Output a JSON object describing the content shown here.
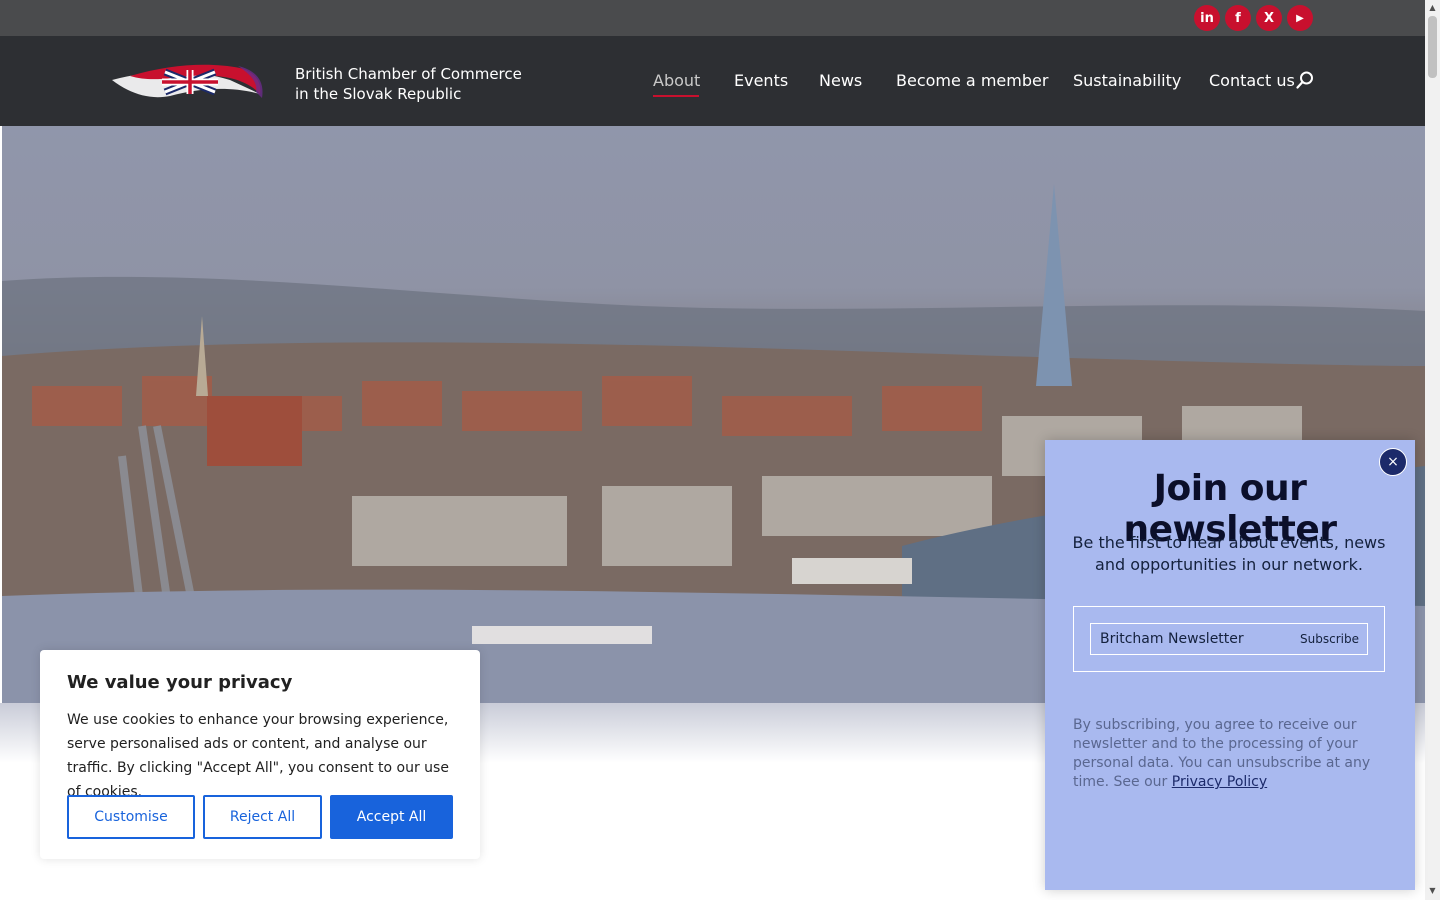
{
  "topbar": {
    "social": [
      {
        "name": "linkedin",
        "glyph": "in"
      },
      {
        "name": "facebook",
        "glyph": "f"
      },
      {
        "name": "x",
        "glyph": "X"
      },
      {
        "name": "youtube",
        "glyph": "▶"
      }
    ]
  },
  "header": {
    "brand_line1": "British Chamber of Commerce",
    "brand_line2": "in the Slovak Republic",
    "nav": [
      "About",
      "Events",
      "News",
      "Become a member",
      "Sustainability",
      "Contact us"
    ],
    "accent": "#c8102e"
  },
  "cookie": {
    "title": "We value your privacy",
    "body": "We use cookies to enhance your browsing experience, serve personalised ads or content, and analyse our traffic. By clicking \"Accept All\", you consent to our use of cookies.",
    "customise": "Customise",
    "reject": "Reject All",
    "accept": "Accept All",
    "button_color": "#1863dc"
  },
  "newsletter": {
    "close": "×",
    "title": "Join our newsletter",
    "subtitle": "Be the first to hear about events, news and opportunities in our network.",
    "input_value": "Britcham Newsletter",
    "subscribe": "Subscribe",
    "legal": "By subscribing, you agree to receive our newsletter and to the processing of your personal data. You can unsubscribe at any time. See our",
    "privacy_link": "Privacy Policy",
    "background": "#a9b9ef"
  },
  "scrollbar": {
    "up": "▲",
    "down": "▼"
  }
}
